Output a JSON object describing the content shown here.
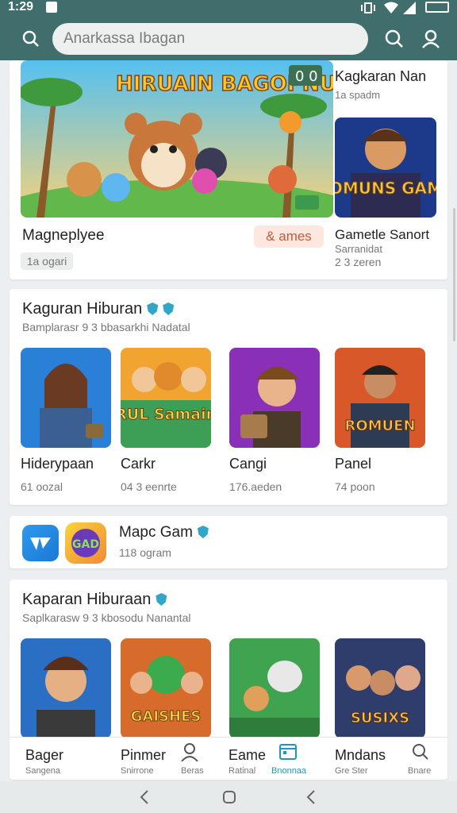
{
  "status_bar": {
    "time": "1:29"
  },
  "header": {
    "search_placeholder": "Anarkassa Ibagan"
  },
  "hero": {
    "banner_text": "HIRUAIN BAGOPNUAS",
    "badge": "0 0",
    "title": "Magneplyee",
    "chip": "& ames",
    "size": "1a ogari",
    "side_title": "Kagkaran Nan",
    "side_subtitle": "1a spadm",
    "side_thumb_text": "SOMUNS GAME",
    "side_title2": "Gametle Sanort",
    "side_subtitle2": "Sarranidat",
    "side_subtitle3": "2 3 zeren"
  },
  "section1": {
    "title": "Kaguran Hiburan",
    "subtitle": "Bamplarasr 9 3 bbasarkhi Nadatal",
    "items": [
      {
        "name": "Hiderypaan",
        "size": "61 oozal",
        "thumb_text": ""
      },
      {
        "name": "Carkr",
        "size": "04 3 eenrte",
        "thumb_text": "PRUL Samaing"
      },
      {
        "name": "Cangi",
        "size": "176.aeden",
        "thumb_text": ""
      },
      {
        "name": "Panel",
        "size": "74 poon",
        "thumb_text": "ROMUEN"
      }
    ]
  },
  "strip": {
    "title": "Mapc Gam",
    "subtitle": "118 ogram",
    "icon_text": "GAD"
  },
  "section2": {
    "title": "Kaparan Hiburaan",
    "subtitle": "Saplkarasw 9 3 kbosodu Nanantal",
    "items": [
      {
        "name": "",
        "thumb_text": ""
      },
      {
        "name": "",
        "thumb_text": "GAISHES"
      },
      {
        "name": "",
        "thumb_text": ""
      },
      {
        "name": "",
        "thumb_text": "SUSIXS"
      }
    ]
  },
  "bottom_nav": [
    {
      "label": "Bager",
      "sub": "Sangena"
    },
    {
      "label": "Pinmer",
      "sub": "Snirrone"
    },
    {
      "label": "",
      "sub": "Beras"
    },
    {
      "label": "Eame",
      "sub": "Ratinal"
    },
    {
      "label": "",
      "sub": "Bnonnaa"
    },
    {
      "label": "Mndans",
      "sub": "Gre Ster"
    },
    {
      "label": "",
      "sub": "Bnare"
    }
  ],
  "colors": {
    "header": "#3f6e6c",
    "accent": "#1f98b8",
    "chip_bg": "#fde7df"
  }
}
